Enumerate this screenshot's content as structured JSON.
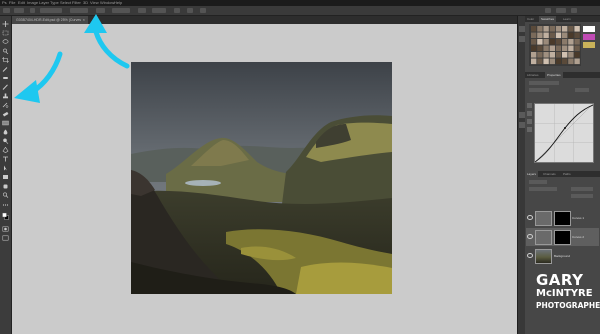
{
  "menu": [
    "File",
    "Edit",
    "Image",
    "Layer",
    "Type",
    "Select",
    "Filter",
    "3D",
    "View",
    "Window",
    "Help"
  ],
  "document": {
    "tab_label": "G03B7404-HDR-Edit.psd @ 25% (Curves 1, RGB/8)",
    "close_glyph": "×"
  },
  "panel_tabs_top": [
    "Color",
    "Swatches",
    "Learn"
  ],
  "panel_tabs_mid": [
    "Libraries",
    "Properties"
  ],
  "panel_tabs_layers": [
    "Layers",
    "Channels",
    "Paths"
  ],
  "layers": [
    {
      "name": "Curves 1",
      "icon": "curves-adjustment-icon"
    },
    {
      "name": "Curves 2",
      "icon": "curves-adjustment-icon"
    },
    {
      "name": "Background",
      "icon": "image-thumbnail"
    }
  ],
  "watermark": {
    "line1": "GARY",
    "line2": "McINTYRE",
    "line3": "PHOTOGRAPHER"
  },
  "colors": {
    "arrow": "#1ec8f0",
    "canvas_bg": "#cbcbcb",
    "panel_bg": "#474747"
  }
}
